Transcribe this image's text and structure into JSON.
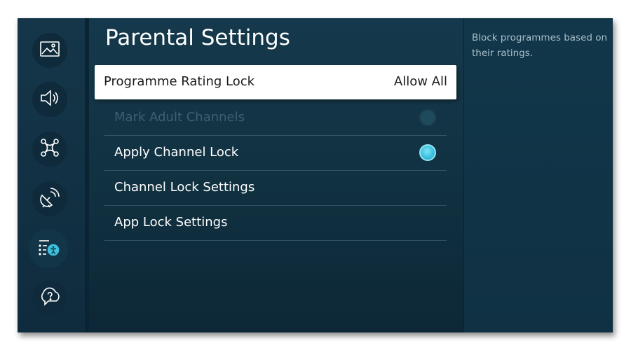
{
  "sidebar": {
    "items": [
      {
        "icon": "picture-icon"
      },
      {
        "icon": "sound-icon"
      },
      {
        "icon": "connection-icon"
      },
      {
        "icon": "broadcasting-icon"
      },
      {
        "icon": "general-accessibility-icon",
        "active": true
      },
      {
        "icon": "support-icon"
      }
    ]
  },
  "main": {
    "title": "Parental Settings",
    "items": [
      {
        "label": "Programme Rating Lock",
        "value": "Allow All",
        "selected": true
      },
      {
        "label": "Mark Adult Channels",
        "toggle": "off",
        "disabled": true
      },
      {
        "label": "Apply Channel Lock",
        "toggle": "on"
      },
      {
        "label": "Channel Lock Settings"
      },
      {
        "label": "App Lock Settings"
      }
    ]
  },
  "description": {
    "text": "Block programmes based on their ratings."
  },
  "colors": {
    "accent": "#3cc1df",
    "background": "#12374a",
    "selected_bg": "#ffffff"
  }
}
